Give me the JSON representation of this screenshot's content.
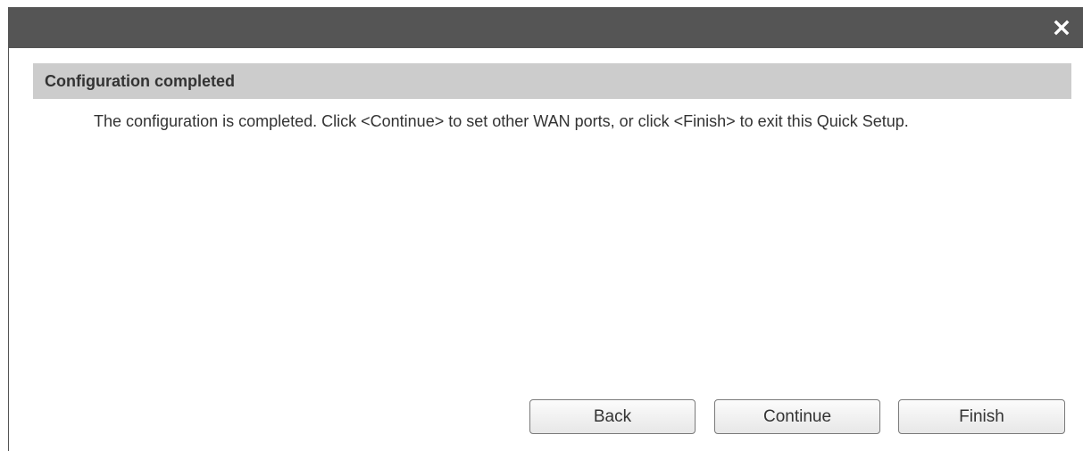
{
  "dialog": {
    "close_icon": "close-icon",
    "section_title": "Configuration completed",
    "message": "The configuration is completed. Click <Continue> to set other WAN ports, or click <Finish> to exit this Quick Setup."
  },
  "buttons": {
    "back_label": "Back",
    "continue_label": "Continue",
    "finish_label": "Finish"
  },
  "colors": {
    "titlebar": "#555555",
    "section_header": "#cccccc",
    "text": "#333333"
  }
}
